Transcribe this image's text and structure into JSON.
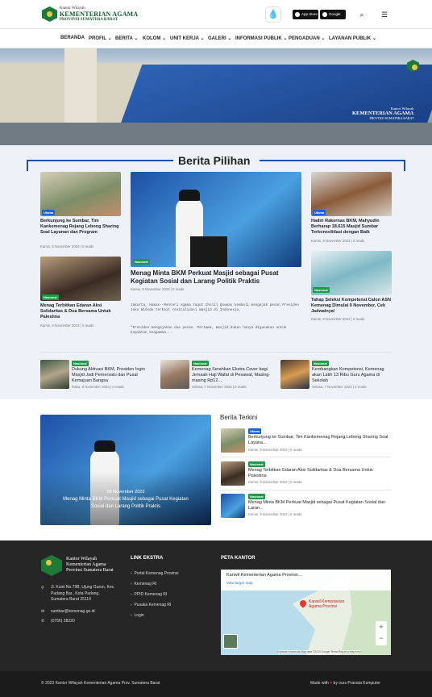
{
  "header": {
    "brand_small": "Kantor Wilayah",
    "brand_main": "KEMENTERIAN AGAMA",
    "brand_sub": "PROVINSI SUMATERA BARAT",
    "app_store": "App Store",
    "google_play": "Google Play"
  },
  "nav": {
    "items": [
      "BERANDA",
      "PROFIL",
      "BERITA",
      "KOLOM",
      "UNIT KERJA",
      "GALERI",
      "INFORMASI PUBLIK",
      "PENGADUAN",
      "LAYANAN PUBLIK"
    ]
  },
  "hero": {
    "logo_small": "Kantor Wilayah",
    "logo_main": "KEMENTERIAN AGAMA",
    "logo_sub": "PROVINSI SUMATERA BARAT"
  },
  "berita_pilihan": {
    "title": "Berita Pilihan",
    "left": [
      {
        "badge": "Utama",
        "title": "Berkunjung ke Sumbar, Tim Kankemenag Rejang Lebong Sharing Soal Layanan dan Program",
        "meta": "Kamis, 9 November 2023 | 0 reads"
      },
      {
        "badge": "Nasional",
        "title": "Menag Terbitkan Edaran Aksi Solidaritas & Doa Bersama Untuk Palestina",
        "meta": "Kamis, 9 November 2023 | 0 reads"
      }
    ],
    "main": {
      "badge": "Nasional",
      "title": "Menag Minta BKM Perkuat Masjid sebagai Pusat Kegiatan Sosial dan Larang Politik Praktis",
      "meta": "Kamis, 9 November 2023 | 0 reads",
      "excerpt1": "Jakarta, Humas--Menteri Agama Yaqut Cholil Qoumas kembali mengajak pesan Presiden Joko Widodo terkait revitalisasi masjid di Indonesia.",
      "excerpt2": "\"Presiden mengajakan dua pesan. Pertama, masjid bukan hanya digunakan untuk kegiatan keagamaa..."
    },
    "right": [
      {
        "badge": "Utama",
        "title": "Hadiri Rakernas BKM, Mahyudin Berharap 18.615 Masjid Sumbar Terkonsolidasi dengan Baik",
        "meta": "Kamis, 9 November 2023 | 0 reads"
      },
      {
        "badge": "Nasional",
        "title": "Tahap Seleksi Kompetensi Calon ASN Kemenag Dimulai 9 November, Cek Jadwalnya!",
        "meta": "Kamis, 9 November 2023 | 0 reads"
      }
    ],
    "row": [
      {
        "badge": "Nasional",
        "title": "Dukung Aktivasi BKM, Presiden Ingin Masjid Jadi Pemersatu dan Pusat Kemajuan Bangsa",
        "meta": "Rabu, 8 November 2023 | 0 reads"
      },
      {
        "badge": "Nasional",
        "title": "Kemenag Serahkan Ekstra Cover bagi Jemaah Haji Wafat di Pesawat, Masing-masing Rp12...",
        "meta": "Selasa, 7 November 2023 | 0 reads"
      },
      {
        "badge": "Nasional",
        "title": "Kembangkan Kompetensi, Kemenag akan Latih 13 Ribu Guru Agama di Sekolah",
        "meta": "Selasa, 7 November 2023 | 2 reads"
      }
    ]
  },
  "featured": {
    "date": "09 November 2023",
    "title": "Menag Minta BKM Perkuat Masjid sebagai Pusat Kegiatan Sosial dan Larang Politik Praktis"
  },
  "terkini": {
    "title": "Berita Terkini",
    "items": [
      {
        "badge": "Utama",
        "title": "Berkunjung ke Sumbar, Tim Kankemenag Rejang Lebong Sharing Soal Layana...",
        "meta": "Kamis, 9 November 2023 | 0 reads"
      },
      {
        "badge": "Nasional",
        "title": "Menag Terbitkan Edaran Aksi Solidaritas & Doa Bersama Untuk Palestina",
        "meta": "Kamis, 9 November 2023 | 0 reads"
      },
      {
        "badge": "Nasional",
        "title": "Menag Minta BKM Perkuat Masjid sebagai Pusat Kegiatan Sosial dan Laran...",
        "meta": "Kamis, 9 November 2023 | 0 reads"
      }
    ]
  },
  "footer": {
    "org_line1": "Kantor Wilayah",
    "org_line2": "Kementerian Agama",
    "org_line3": "Provinsi Sumatera Barat",
    "address": "Jl. Kuini No.79B, Ujung Gurun, Kec. Padang Bar., Kota Padang, Sumatera Barat 25114",
    "email": "sumbar@kemenag.go.id",
    "phone": "(0756) 28220",
    "links_title": "LINK EKSTRA",
    "links": [
      "Portal Kemenag Provinsi",
      "Kemenag RI",
      "PPID Kemenag RI",
      "Pusaka Kemenag RI",
      "Login"
    ],
    "map_title": "PETA KANTOR",
    "map_place": "Kanwil Kementerian Agama Provinsi...",
    "map_link": "View larger map",
    "map_pin_label": "Kanwil Kementerian Agama Provinsi",
    "map_footer": "Keyboard shortcuts   Map data ©2023 Google   Terms   Report a map error",
    "copyright": "© 2023 Kantor Wilayah Kementerian Agama Prov. Sumatera Barat",
    "made_with": "Made with",
    "by": "by ours Pranata Komputer"
  },
  "colors": {
    "accent": "#1d4fb0",
    "brand_green": "#0d5c2b",
    "badge_blue": "#1d63d6",
    "badge_green": "#1a9b46",
    "heart": "#e0245e"
  },
  "icons": [
    "drop-icon",
    "search-icon",
    "menu-icon",
    "location-icon",
    "mail-icon",
    "phone-icon",
    "chevron-right-icon",
    "heart-icon",
    "map-pin-icon",
    "zoom-in-icon",
    "zoom-out-icon"
  ]
}
